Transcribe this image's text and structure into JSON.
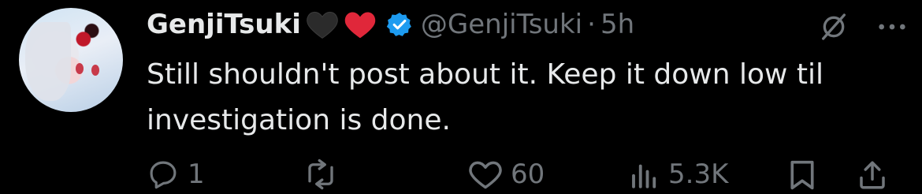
{
  "tweet": {
    "display_name": "GenjiTsuki",
    "name_emojis": [
      "black-heart",
      "red-heart"
    ],
    "verified": true,
    "handle": "@GenjiTsuki",
    "separator": "·",
    "time": "5h",
    "text": "Still shouldn't post about it. Keep it down low til investigation is done."
  },
  "actions": {
    "reply_count": "1",
    "repost_count": "",
    "like_count": "60",
    "views_count": "5.3K"
  },
  "colors": {
    "background": "#000000",
    "text": "#e7e9ea",
    "muted": "#71767b",
    "verified": "#1d9bf0",
    "heart_red": "#e0273a"
  }
}
